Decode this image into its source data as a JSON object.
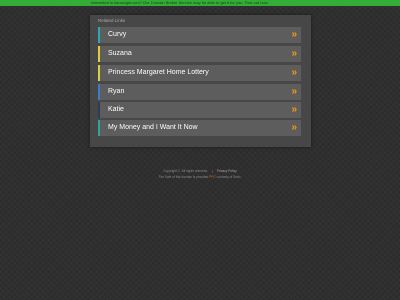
{
  "banner": {
    "text": "Interested in lotoslogia.com? Our Domain Broker Service may be able to get it for you. Find out how."
  },
  "panel": {
    "title": "Related Links"
  },
  "links": [
    {
      "label": "Curvy",
      "accent": "#2aa8b8"
    },
    {
      "label": "Suzana",
      "accent": "#e8c93a"
    },
    {
      "label": "Princess Margaret Home Lottery",
      "accent": "#d7d33a"
    },
    {
      "label": "Ryan",
      "accent": "#3a7dc8"
    },
    {
      "label": "Katie",
      "accent": "#2b3d5a"
    },
    {
      "label": "My Money and I Want It Now",
      "accent": "#2aa890"
    }
  ],
  "link_arrow_icon": "double-chevron-right-icon",
  "link_arrow_glyph": "»",
  "footer": {
    "copyright": "Copyright ©. All rights reserved.",
    "separator": "|",
    "privacy": "Privacy Policy",
    "line2_prefix": "The Sale of this domain is provided",
    "line2_highlight": "PPC",
    "line2_suffix": "courtesy of Sedo."
  }
}
